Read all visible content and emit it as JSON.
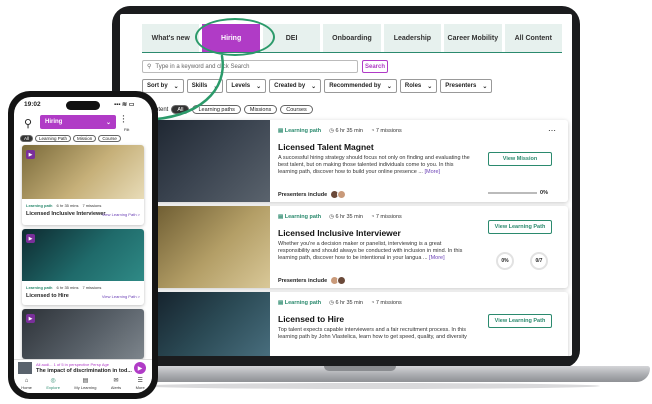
{
  "colors": {
    "accent": "#b03bc6",
    "green": "#2b8a6e",
    "nav_text": "#333333"
  },
  "desktop": {
    "tabs": [
      {
        "label": "What's new",
        "active": false
      },
      {
        "label": "Hiring",
        "active": true
      },
      {
        "label": "DEI",
        "active": false
      },
      {
        "label": "Onboarding",
        "active": false
      },
      {
        "label": "Leadership",
        "active": false
      },
      {
        "label": "Career Mobility",
        "active": false
      },
      {
        "label": "All Content",
        "active": false
      }
    ],
    "search_placeholder": "Type in a keyword and click Search",
    "search_button": "Search",
    "filters": [
      "Sort by",
      "Skills",
      "Levels",
      "Created by",
      "Recommended by",
      "Roles",
      "Presenters"
    ],
    "content_label": "of content",
    "chips": [
      {
        "label": "All",
        "active": true
      },
      {
        "label": "Learning paths",
        "active": false
      },
      {
        "label": "Missions",
        "active": false
      },
      {
        "label": "Courses",
        "active": false
      }
    ],
    "cards": [
      {
        "type": "Learning path",
        "duration": "6 hr 35 min",
        "missions": "7 missions",
        "title": "Licensed Talent Magnet",
        "desc": "A successful hiring strategy should focus not only on finding and evaluating the best talent, but on making those talented individuals come to you. In this learning path, discover how to build your online presence ...",
        "more": "[More]",
        "presenters": "Presenters include",
        "action": "View Mission",
        "progress": "0%"
      },
      {
        "type": "Learning path",
        "duration": "6 hr 35 min",
        "missions": "7 missions",
        "title": "Licensed Inclusive Interviewer",
        "desc": "Whether you're a decision maker or panelist, interviewing is a great responsibility and should always be conducted with inclusion in mind. In this learning path, discover how to be intentional in your langua ...",
        "more": "[More]",
        "presenters": "Presenters include",
        "action": "View Learning Path",
        "ring1": "0%",
        "ring2": "0/7"
      },
      {
        "type": "Learning path",
        "duration": "6 hr 35 min",
        "missions": "7 missions",
        "title": "Licensed to Hire",
        "desc": "Top talent expects capable interviewers and a fair recruitment process. In this learning path by John Vlastelica, learn how to get speed, quality, and diversity",
        "more": "",
        "presenters": "",
        "action": "View Learning Path"
      }
    ]
  },
  "phone": {
    "time": "19:02",
    "status": "▪▪▪ ≋ ▭",
    "dropdown": "Hiring",
    "filter_label": "Filt",
    "chips": [
      {
        "label": "All",
        "active": true
      },
      {
        "label": "Learning Path",
        "active": false
      },
      {
        "label": "Mission",
        "active": false
      },
      {
        "label": "Course",
        "active": false
      }
    ],
    "cards": [
      {
        "type": "Learning path",
        "duration": "6 hr 35 mins",
        "missions": "7 missions",
        "title": "Licensed Inclusive Interviewer",
        "link": "View Learning Path  >"
      },
      {
        "type": "Learning path",
        "duration": "6 hr 35 mins",
        "missions": "7 missions",
        "title": "Licensed to Hire",
        "link": "View Learning Path  >"
      }
    ],
    "now_playing": {
      "sub": "All audi...  1 of 5 in perspective Persp Age",
      "title": "The impact of discrimination in tod..."
    },
    "nav": [
      {
        "label": "Home",
        "icon": "⌂",
        "active": false
      },
      {
        "label": "Explore",
        "icon": "◎",
        "active": true
      },
      {
        "label": "My Learning",
        "icon": "▤",
        "active": false
      },
      {
        "label": "Alerts",
        "icon": "✉",
        "active": false
      },
      {
        "label": "More",
        "icon": "☰",
        "active": false
      }
    ]
  }
}
